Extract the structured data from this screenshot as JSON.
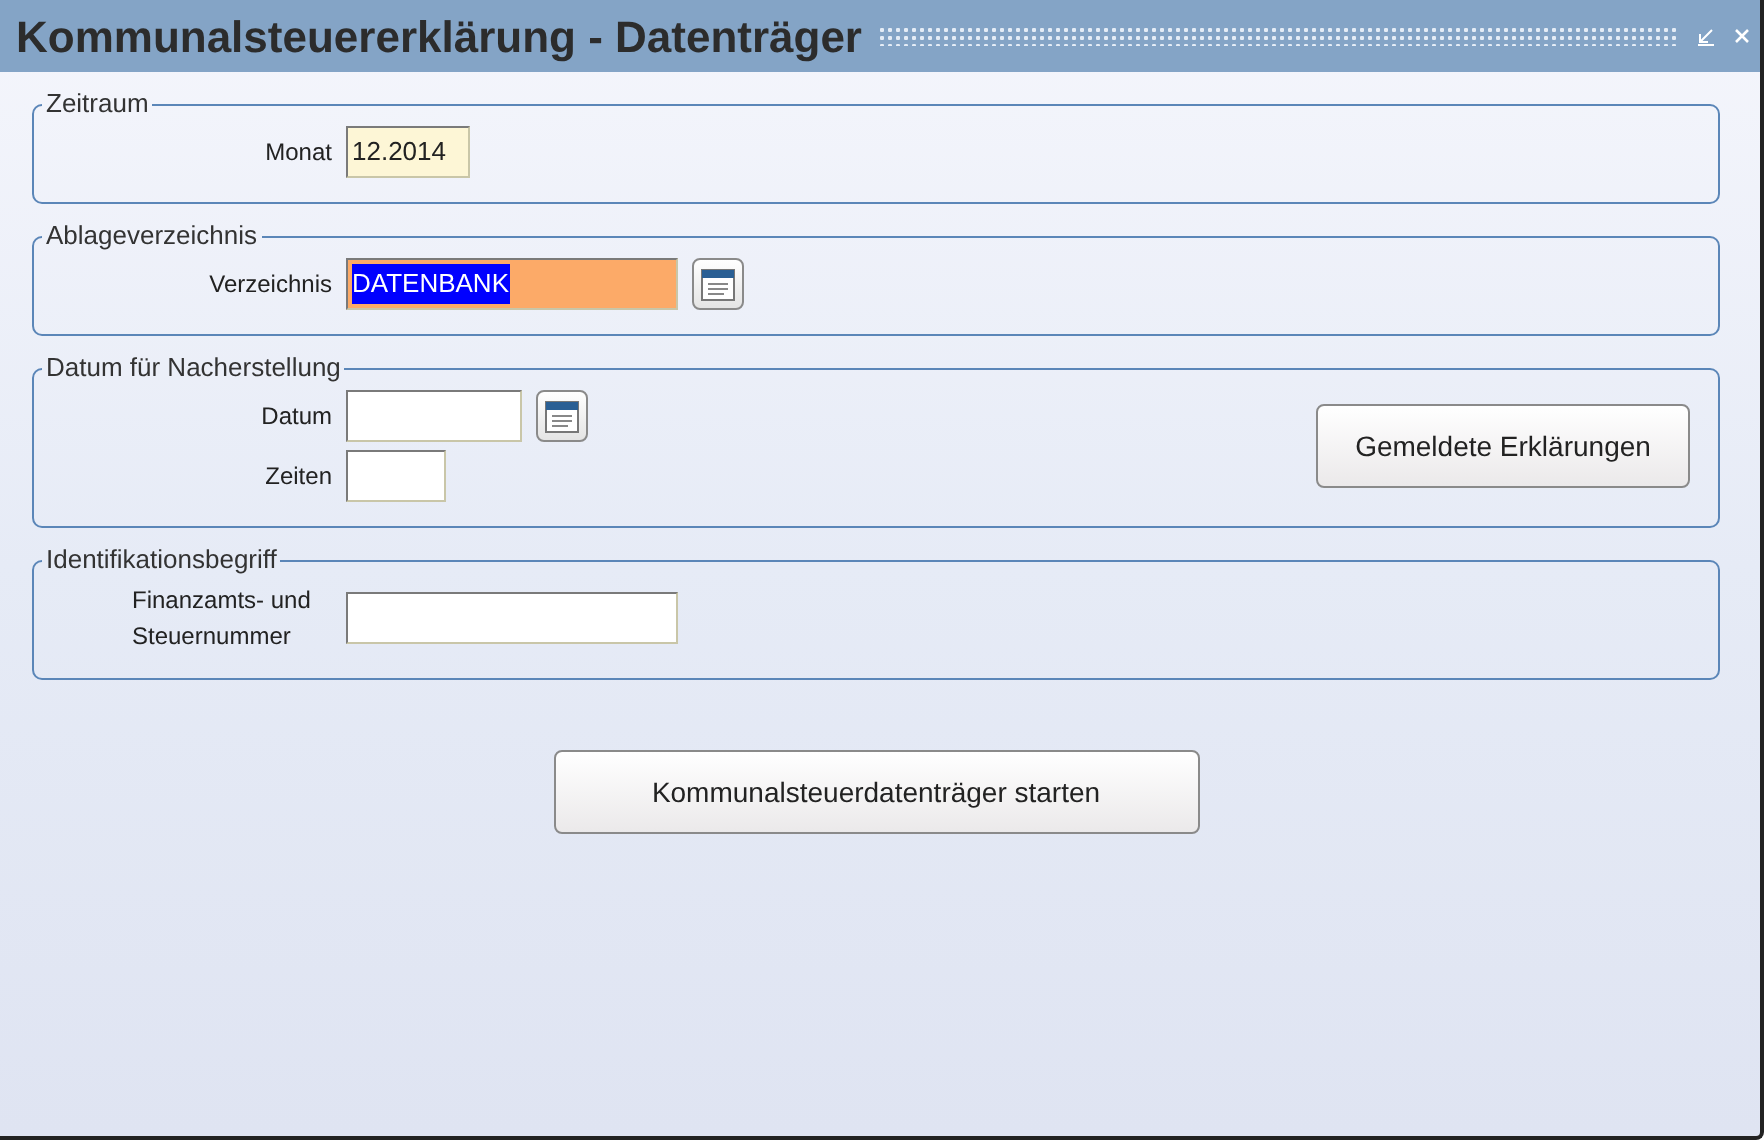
{
  "window": {
    "title": "Kommunalsteuererklärung - Datenträger"
  },
  "groups": [
    {
      "title": "Zeitraum",
      "fields": [
        {
          "kind": "month",
          "label": "Monat",
          "value": "12.2014",
          "picker": false,
          "highlighted": false
        }
      ]
    },
    {
      "title": "Ablageverzeichnis",
      "fields": [
        {
          "kind": "directory",
          "label": "Verzeichnis",
          "value": "DATENBANK",
          "picker": true,
          "highlighted": true
        }
      ]
    },
    {
      "title": "Datum für Nacherstellung",
      "fields": [
        {
          "kind": "date",
          "label": "Datum",
          "picker": true,
          "highlighted": false
        },
        {
          "kind": "count",
          "label": "Zeiten",
          "picker": false,
          "highlighted": false
        }
      ],
      "button": "Gemeldete Erklärungen"
    },
    {
      "title": "Identifikationsbegriff",
      "fields": [
        {
          "kind": "id",
          "label": "Finanzamts- und Steuernummer",
          "picker": false,
          "highlighted": false
        }
      ]
    }
  ],
  "start_button": "Kommunalsteuerdatenträger starten"
}
